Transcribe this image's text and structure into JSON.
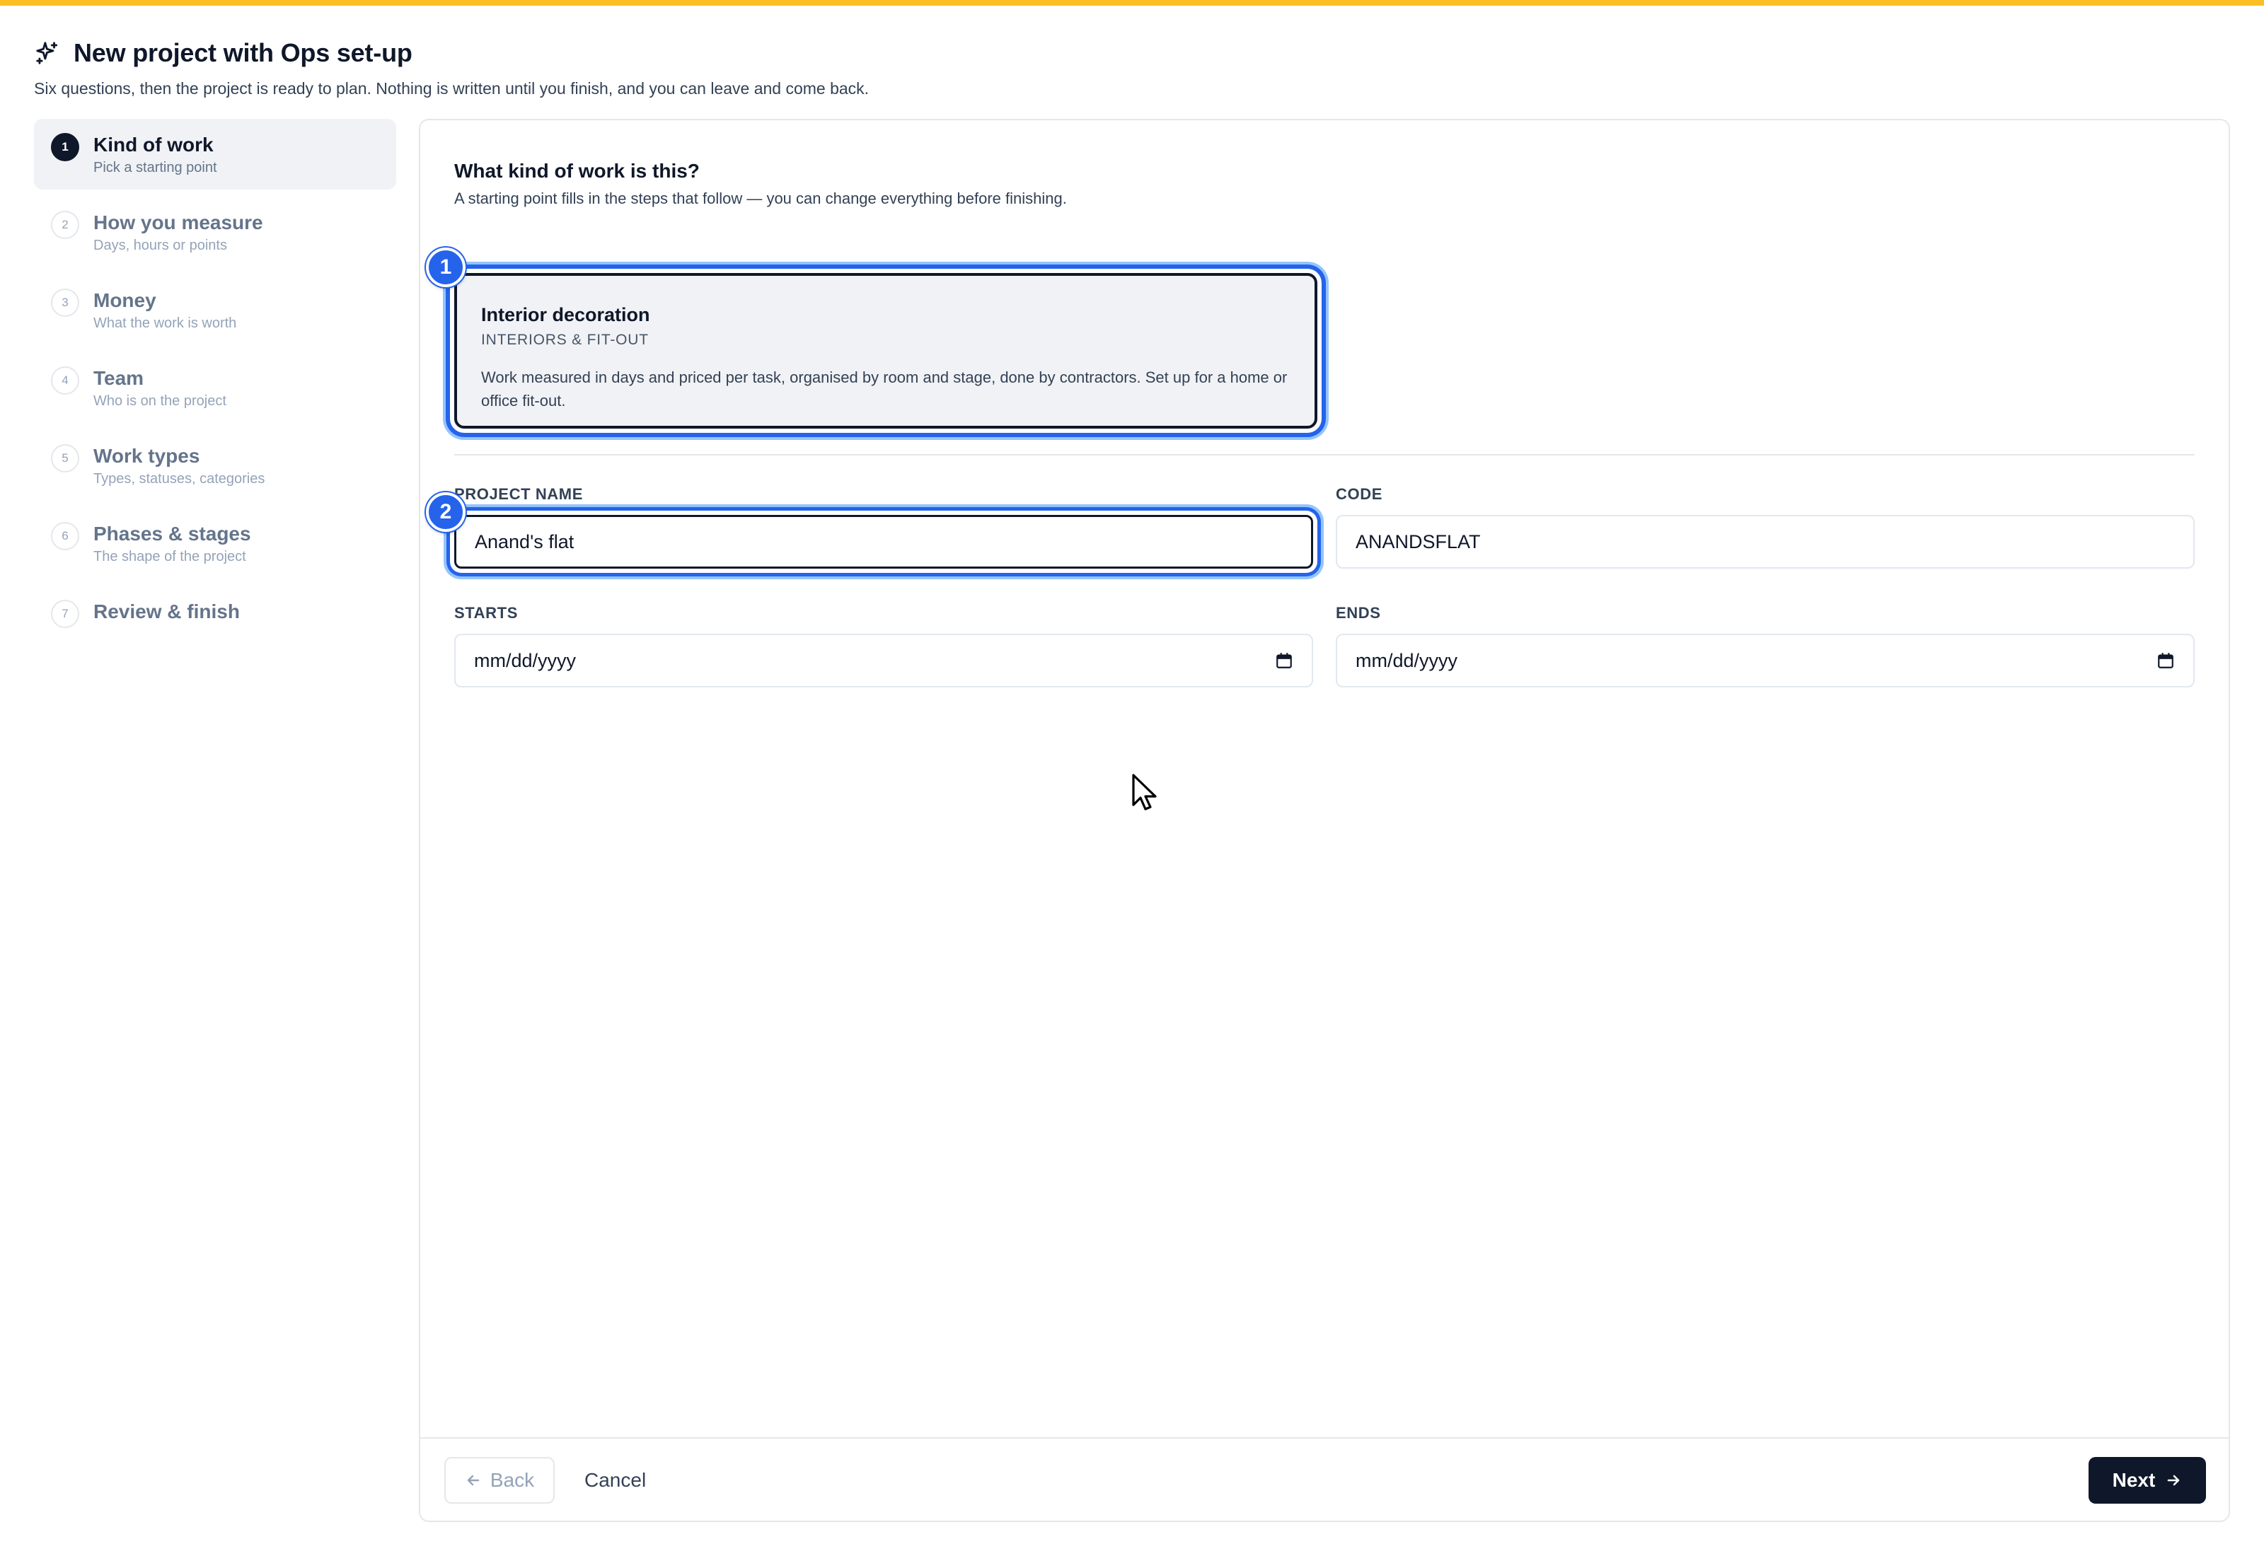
{
  "header": {
    "title": "New project with Ops set-up",
    "subtitle": "Six questions, then the project is ready to plan. Nothing is written until you finish, and you can leave and come back."
  },
  "sidebar": {
    "steps": [
      {
        "num": "1",
        "label": "Kind of work",
        "sub": "Pick a starting point",
        "active": true
      },
      {
        "num": "2",
        "label": "How you measure",
        "sub": "Days, hours or points"
      },
      {
        "num": "3",
        "label": "Money",
        "sub": "What the work is worth"
      },
      {
        "num": "4",
        "label": "Team",
        "sub": "Who is on the project"
      },
      {
        "num": "5",
        "label": "Work types",
        "sub": "Types, statuses, categories"
      },
      {
        "num": "6",
        "label": "Phases & stages",
        "sub": "The shape of the project"
      },
      {
        "num": "7",
        "label": "Review & finish",
        "sub": ""
      }
    ]
  },
  "main": {
    "question": "What kind of work is this?",
    "question_sub": "A starting point fills in the steps that follow — you can change everything before finishing.",
    "option": {
      "title": "Interior decoration",
      "tag": "INTERIORS & FIT-OUT",
      "description": "Work measured in days and priced per task, organised by room and stage, done by contractors. Set up for a home or office fit-out."
    },
    "badges": [
      "1",
      "2"
    ],
    "fields": {
      "project_name": {
        "label": "PROJECT NAME",
        "value": "Anand's flat"
      },
      "code": {
        "label": "CODE",
        "value": "ANANDSFLAT"
      },
      "starts": {
        "label": "STARTS",
        "value": "mm/dd/yyyy"
      },
      "ends": {
        "label": "ENDS",
        "value": "mm/dd/yyyy"
      }
    }
  },
  "footer": {
    "back_label": "Back",
    "cancel_label": "Cancel",
    "next_label": "Next"
  },
  "icons": {
    "title": "sparkles-icon",
    "back": "arrow-left-icon",
    "next": "arrow-right-icon",
    "date": "calendar-icon"
  },
  "colors": {
    "accent_stripe": "#fbbf24",
    "focus_ring": "#2563eb",
    "primary": "#0f172a"
  }
}
